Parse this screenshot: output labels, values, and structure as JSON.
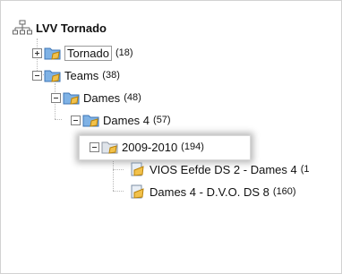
{
  "tree": {
    "root": {
      "label": "LVV Tornado",
      "icon": "sitemap-icon"
    },
    "nodes": [
      {
        "label": "Tornado",
        "count": "(18)",
        "expander": "plus"
      },
      {
        "label": "Teams",
        "count": "(38)",
        "expander": "minus"
      },
      {
        "label": "Dames",
        "count": "(48)",
        "expander": "minus"
      },
      {
        "label": "Dames 4",
        "count": "(57)",
        "expander": "minus"
      },
      {
        "label": "2009-2010",
        "count": "(194)",
        "expander": "minus"
      },
      {
        "label": "VIOS Eefde DS 2 - Dames 4",
        "count": "(1",
        "expander": "none"
      },
      {
        "label": "Dames 4 - D.V.O. DS 8",
        "count": "(160)",
        "expander": "none"
      }
    ]
  },
  "colors": {
    "folder_blue": "#4a86c8",
    "folder_gold": "#e4a81c",
    "selection_border": "#d9d9d9"
  }
}
